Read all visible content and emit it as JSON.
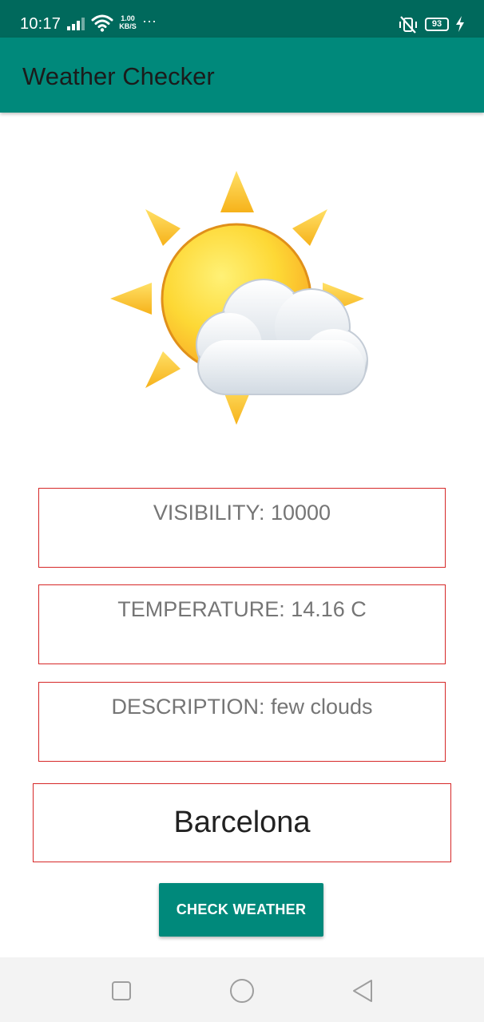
{
  "status_bar": {
    "time": "10:17",
    "speed_value": "1.00",
    "speed_unit": "KB/S",
    "more": "···",
    "battery": "93",
    "icons": [
      "signal-icon",
      "wifi-icon",
      "vibrate-mute-icon",
      "battery-icon",
      "charging-icon"
    ]
  },
  "app_bar": {
    "title": "Weather Checker"
  },
  "weather": {
    "icon": "sun-behind-cloud-icon",
    "visibility": "VISIBILITY: 10000",
    "temperature": "TEMPERATURE: 14.16 C",
    "description": "DESCRIPTION: few clouds"
  },
  "city_input": {
    "value": "Barcelona"
  },
  "check_button": {
    "label": "CHECK WEATHER"
  },
  "nav_bar": {
    "icons": [
      "recent-apps-icon",
      "home-icon",
      "back-icon"
    ]
  },
  "colors": {
    "status_bar": "#00695c",
    "app_bar": "#00897b",
    "button": "#00897b",
    "border": "#d62828",
    "info_text": "#757575"
  }
}
